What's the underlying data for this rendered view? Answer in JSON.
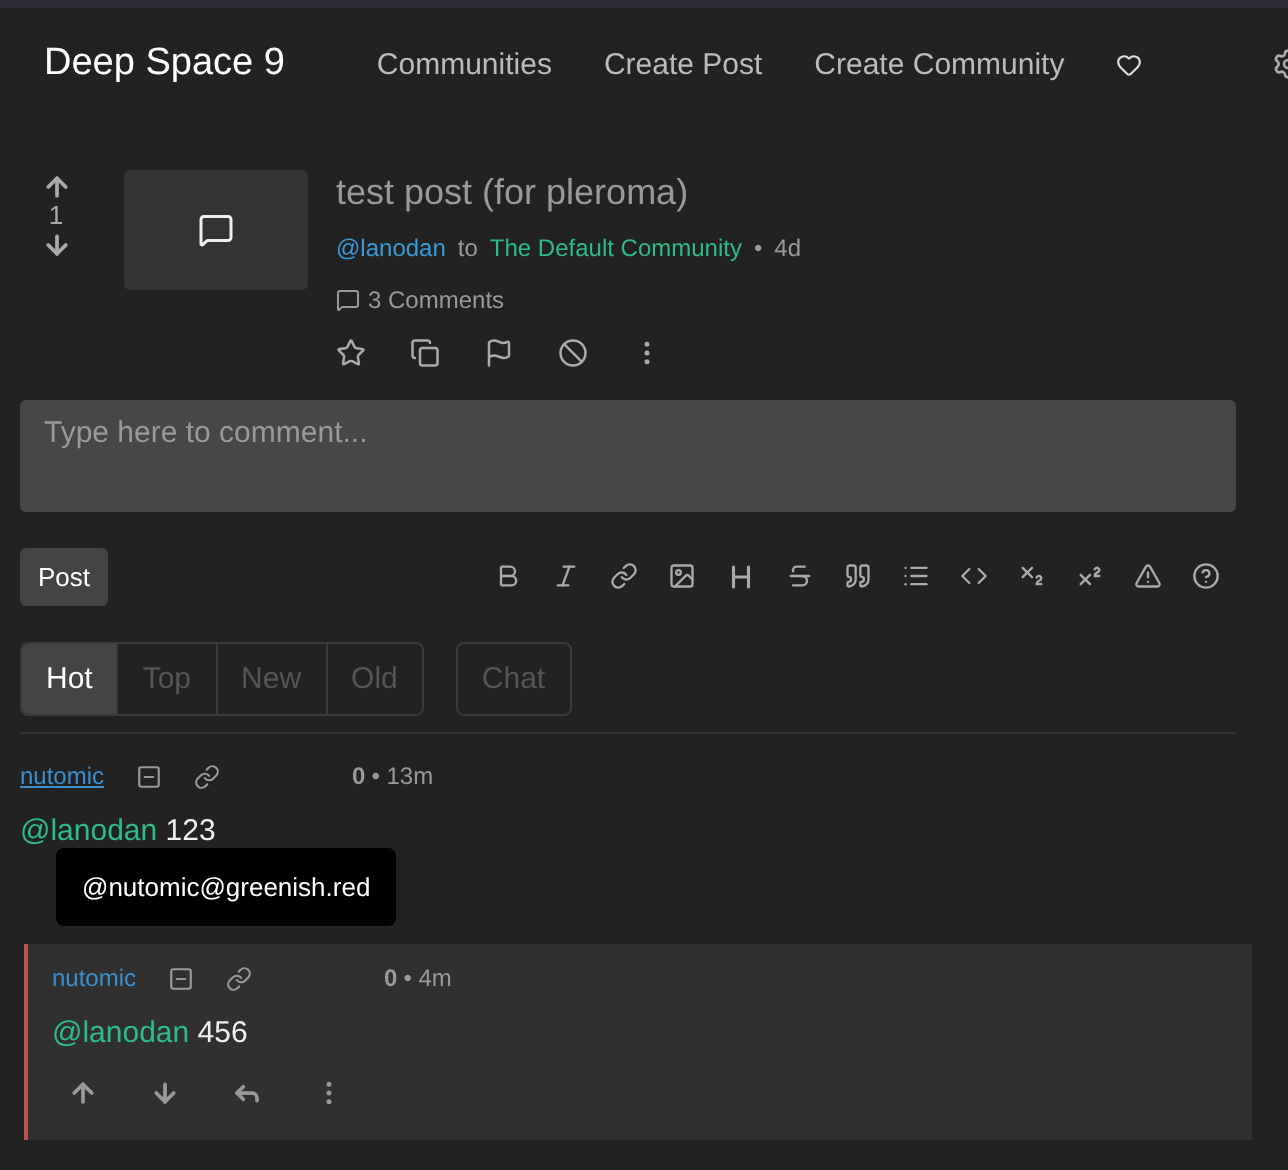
{
  "navbar": {
    "brand": "Deep Space 9",
    "links": [
      "Communities",
      "Create Post",
      "Create Community"
    ]
  },
  "post": {
    "score": "1",
    "title": "test post (for pleroma)",
    "author": "@lanodan",
    "to": "to",
    "community": "The Default Community",
    "dot": "•",
    "age": "4d",
    "comments": "3 Comments"
  },
  "editor": {
    "placeholder": "Type here to comment..."
  },
  "post_button": "Post",
  "sort_tabs": [
    {
      "label": "Hot",
      "selected": true
    },
    {
      "label": "Top",
      "selected": false
    },
    {
      "label": "New",
      "selected": false
    },
    {
      "label": "Old",
      "selected": false
    }
  ],
  "chat_button": "Chat",
  "comments": [
    {
      "author": "nutomic",
      "score": "0",
      "age": "• 13m",
      "mention": "@lanodan",
      "text": "123",
      "actions_visible": false,
      "children": [
        {
          "author": "nutomic",
          "score": "0",
          "age": "• 4m",
          "mention": "@lanodan",
          "text": "456",
          "actions_visible": true
        }
      ]
    }
  ],
  "tooltip": {
    "text": "@nutomic@greenish.red"
  }
}
